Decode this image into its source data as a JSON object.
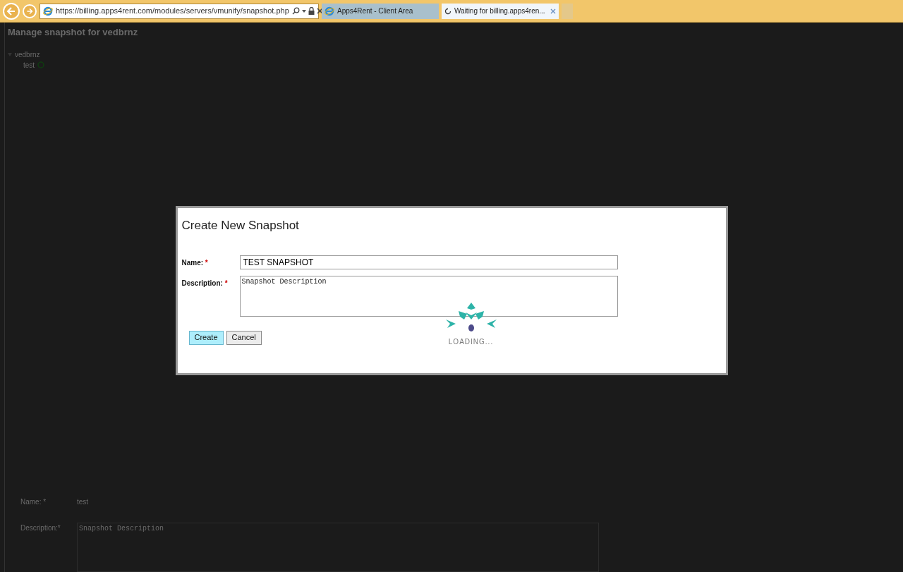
{
  "browser": {
    "url": "https://billing.apps4rent.com/modules/servers/vmunify/snapshot.php",
    "tabs": [
      {
        "title": "Apps4Rent - Client Area",
        "selected": false,
        "loading": false
      },
      {
        "title": "Waiting for billing.apps4ren...",
        "selected": true,
        "loading": true
      }
    ]
  },
  "page": {
    "title": "Manage snapshot for vedbrnz",
    "tree": [
      {
        "label": "vedbrnz",
        "expanded": true,
        "children": [
          {
            "label": "test"
          }
        ]
      }
    ],
    "form": {
      "name_label": "Name: *",
      "name_value": "test",
      "description_label": "Description:*",
      "description_value": "Snapshot Description"
    }
  },
  "dialog": {
    "title": "Create New Snapshot",
    "fields": [
      {
        "kind": "text",
        "label": "Name:",
        "required": true,
        "value": "TEST SNAPSHOT"
      },
      {
        "kind": "textarea",
        "label": "Description:",
        "required": true,
        "value": "Snapshot Description"
      }
    ],
    "required_mark": "*",
    "buttons": [
      {
        "label": "Create",
        "primary": true
      },
      {
        "label": "Cancel",
        "primary": false
      }
    ],
    "loading_text": "LOADING..."
  }
}
